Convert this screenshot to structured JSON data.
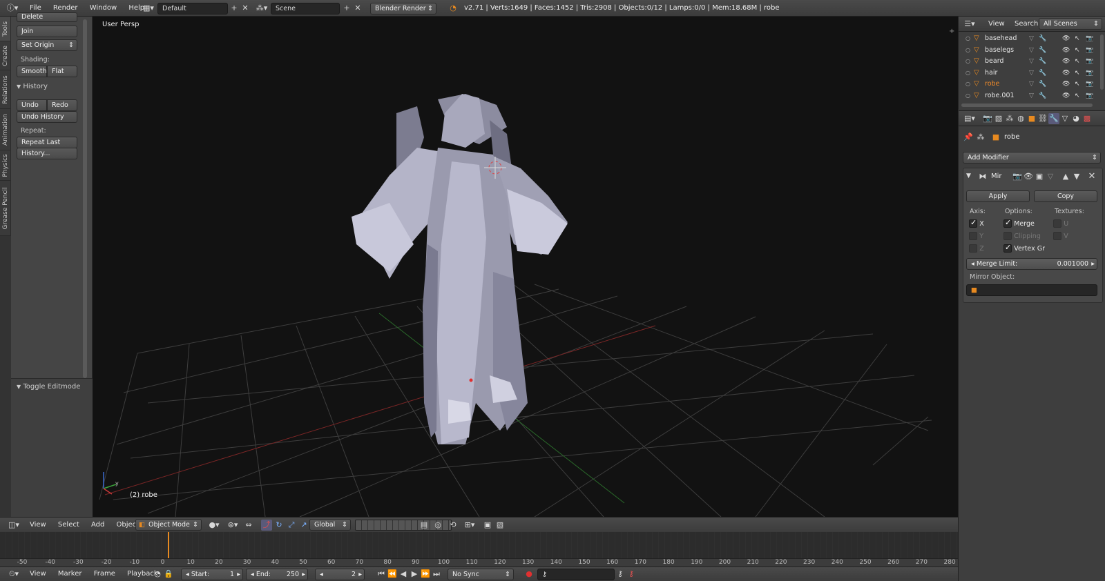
{
  "top_header": {
    "menus": [
      "File",
      "Render",
      "Window",
      "Help"
    ],
    "layout_name": "Default",
    "scene_name": "Scene",
    "engine": "Blender Render",
    "stats": "v2.71 | Verts:1649 | Faces:1452 | Tris:2908 | Objects:0/12 | Lamps:0/0 | Mem:18.68M | robe"
  },
  "tool_tabs": [
    "Tools",
    "Create",
    "Relations",
    "Animation",
    "Physics",
    "Grease Pencil"
  ],
  "tool_shelf": {
    "delete_label": "Delete",
    "join_label": "Join",
    "set_origin_label": "Set Origin",
    "shading_label": "Shading:",
    "smooth_label": "Smooth",
    "flat_label": "Flat",
    "history_header": "History",
    "undo_label": "Undo",
    "redo_label": "Redo",
    "undo_history_label": "Undo History",
    "repeat_label": "Repeat:",
    "repeat_last_label": "Repeat Last",
    "history_dots_label": "History...",
    "toggle_editmode_label": "Toggle Editmode"
  },
  "viewport": {
    "view_name": "User Persp",
    "object_info": "(2) robe",
    "axis_y": "y"
  },
  "view3d_header": {
    "menus": [
      "View",
      "Select",
      "Add",
      "Object"
    ],
    "mode": "Object Mode",
    "orientation": "Global"
  },
  "timeline": {
    "ruler_labels": [
      "-50",
      "-40",
      "-30",
      "-20",
      "-10",
      "0",
      "10",
      "20",
      "30",
      "40",
      "50",
      "60",
      "70",
      "80",
      "90",
      "100",
      "110",
      "120",
      "130",
      "140",
      "150",
      "160",
      "170",
      "180",
      "190",
      "200",
      "210",
      "220",
      "230",
      "240",
      "250",
      "260",
      "270",
      "280"
    ],
    "current_frame_marker": 2
  },
  "timeline_header": {
    "menus": [
      "View",
      "Marker",
      "Frame",
      "Playback"
    ],
    "start_label": "Start:",
    "start_value": "1",
    "end_label": "End:",
    "end_value": "250",
    "current_frame": "2",
    "sync": "No Sync"
  },
  "outliner": {
    "menus": [
      "View",
      "Search"
    ],
    "filter": "All Scenes",
    "items": [
      {
        "name": "basehead",
        "active": false
      },
      {
        "name": "baselegs",
        "active": false
      },
      {
        "name": "beard",
        "active": false
      },
      {
        "name": "hair",
        "active": false
      },
      {
        "name": "robe",
        "active": true
      },
      {
        "name": "robe.001",
        "active": false
      }
    ]
  },
  "properties": {
    "object_name": "robe",
    "add_modifier_label": "Add Modifier",
    "modifier_name": "Mir",
    "apply_label": "Apply",
    "copy_label": "Copy",
    "axis_label": "Axis:",
    "options_label": "Options:",
    "textures_label": "Textures:",
    "axis_x": "X",
    "axis_y": "Y",
    "axis_z": "Z",
    "merge_label": "Merge",
    "clipping_label": "Clipping",
    "vertex_gr_label": "Vertex Gr",
    "tex_u": "U",
    "tex_v": "V",
    "merge_limit_label": "Merge Limit:",
    "merge_limit_value": "0.001000",
    "mirror_object_label": "Mirror Object:"
  },
  "colors": {
    "accent_orange": "#e88a20",
    "active_name": "#f08b2a",
    "viewport_bg": "#121212",
    "grid": "#3c3c3c",
    "x_axis": "#8a2a2a",
    "y_axis": "#2e6e2e"
  }
}
